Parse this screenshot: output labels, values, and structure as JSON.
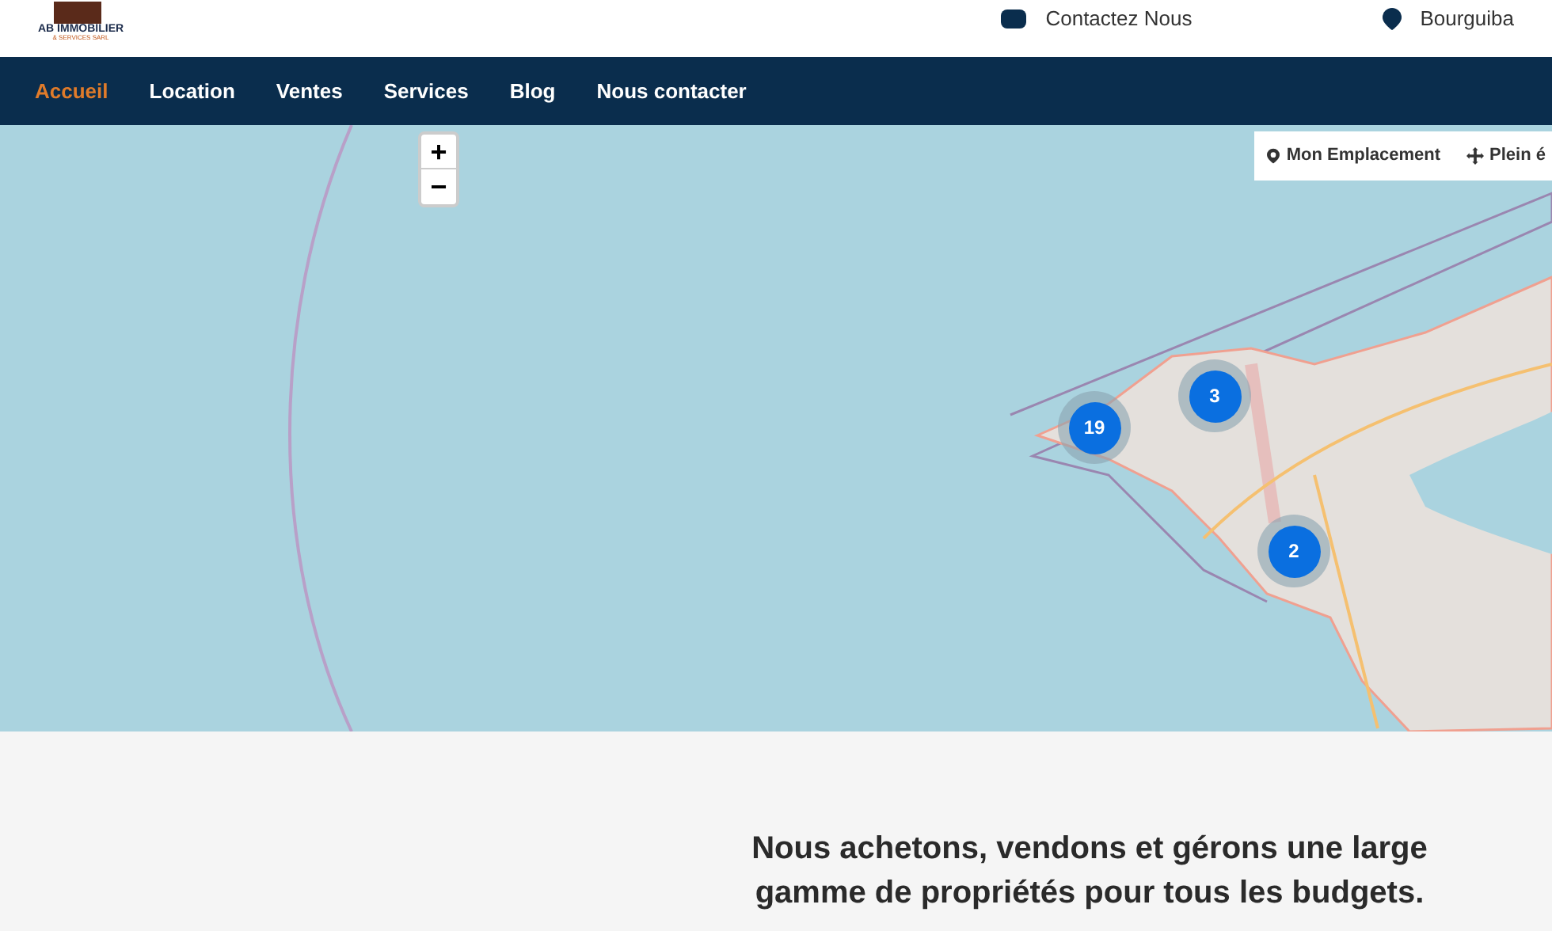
{
  "header": {
    "logo_name": "AB IMMOBILIER",
    "logo_sub": "& SERVICES SARL",
    "contact": "Contactez Nous",
    "address": "Bourguiba"
  },
  "nav": [
    {
      "label": "Accueil",
      "selected": true
    },
    {
      "label": "Location",
      "selected": false
    },
    {
      "label": "Ventes",
      "selected": false
    },
    {
      "label": "Services",
      "selected": false
    },
    {
      "label": "Blog",
      "selected": false
    },
    {
      "label": "Nous contacter",
      "selected": false
    }
  ],
  "map": {
    "zoom_in": "+",
    "zoom_out": "−",
    "locate": "Mon Emplacement",
    "fullscreen": "Plein é",
    "clusters": [
      {
        "count": "19"
      },
      {
        "count": "3"
      },
      {
        "count": "2"
      }
    ]
  },
  "intro": {
    "heading": "Nous achetons, vendons et gérons une large gamme de propriétés pour tous les budgets."
  }
}
